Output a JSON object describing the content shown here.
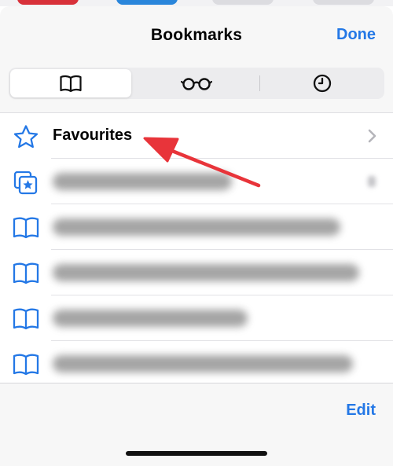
{
  "header": {
    "title": "Bookmarks",
    "done_label": "Done"
  },
  "segments": [
    {
      "icon": "book-icon",
      "selected": true
    },
    {
      "icon": "glasses-icon",
      "selected": false
    },
    {
      "icon": "clock-icon",
      "selected": false
    }
  ],
  "list": {
    "favourites_label": "Favourites",
    "rows": [
      {
        "icon": "favourites-folder-icon"
      },
      {
        "icon": "book-icon"
      },
      {
        "icon": "book-icon"
      },
      {
        "icon": "book-icon"
      },
      {
        "icon": "book-icon"
      }
    ]
  },
  "footer": {
    "edit_label": "Edit"
  },
  "colors": {
    "accent": "#2478e6",
    "arrow": "#e8343a"
  }
}
